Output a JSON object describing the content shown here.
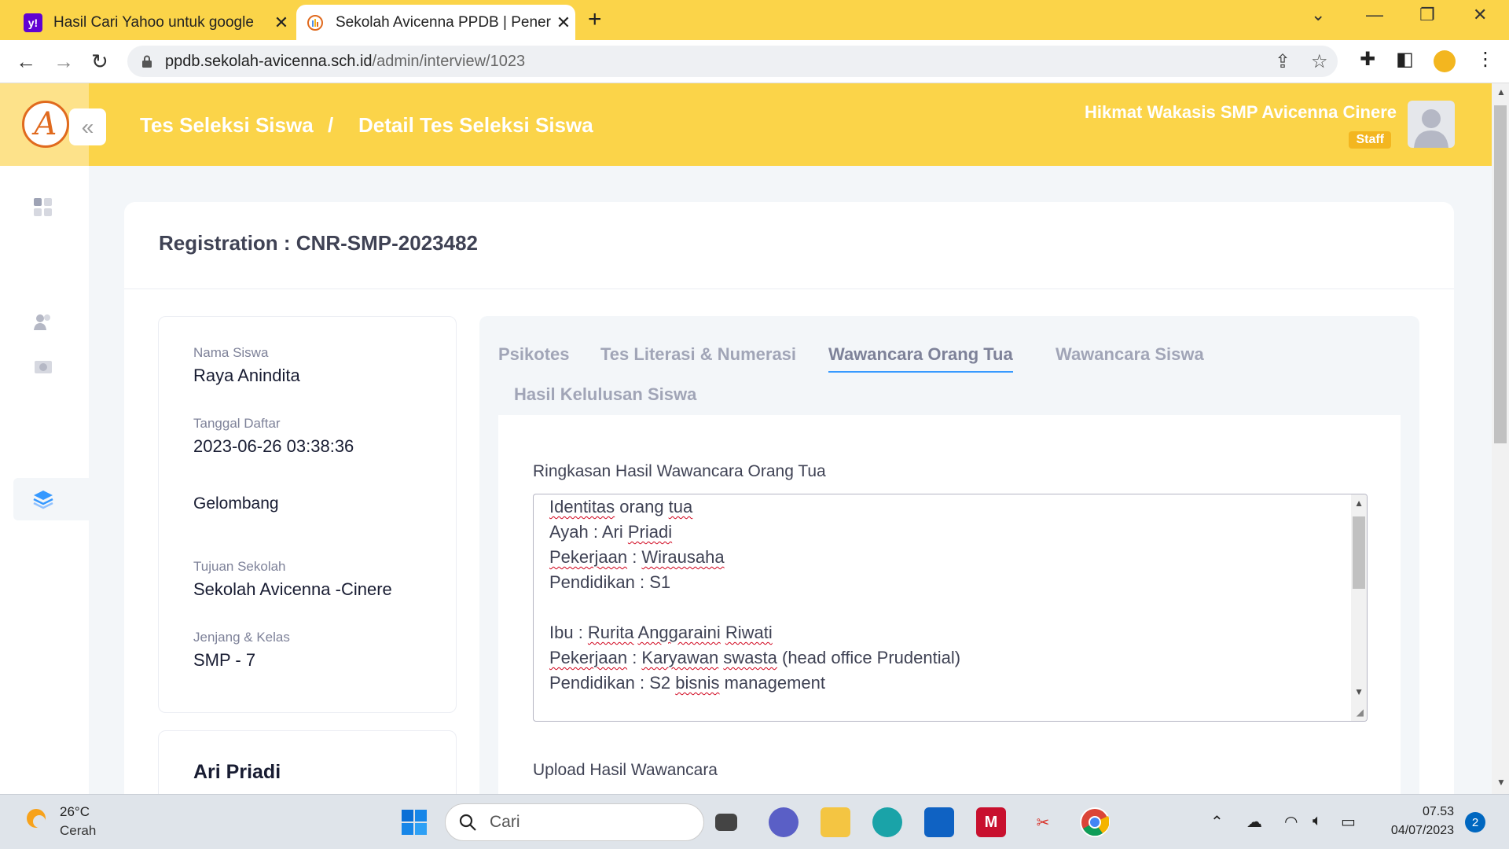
{
  "browser": {
    "tabs": [
      {
        "title": "Hasil Cari Yahoo untuk google",
        "favicon": "y!"
      },
      {
        "title": "Sekolah Avicenna PPDB | Penerim",
        "favicon": "avicenna"
      }
    ],
    "url_host": "ppdb.sekolah-avicenna.sch.id",
    "url_path": "/admin/interview/1023"
  },
  "header": {
    "breadcrumb_1": "Tes Seleksi Siswa",
    "separator": "/",
    "breadcrumb_2": "Detail Tes Seleksi Siswa",
    "user_name": "Hikmat Wakasis SMP Avicenna Cinere",
    "user_role": "Staff"
  },
  "registration": "Registration : CNR-SMP-2023482",
  "student": {
    "name_label": "Nama Siswa",
    "name": "Raya Anindita",
    "date_label": "Tanggal Daftar",
    "date": "2023-06-26 03:38:36",
    "wave_label": "Gelombang",
    "school_label": "Tujuan Sekolah",
    "school": "Sekolah Avicenna -Cinere",
    "level_label": "Jenjang & Kelas",
    "level": "SMP - 7"
  },
  "parent_card": {
    "name": "Ari Priadi"
  },
  "tabs": [
    "Psikotes",
    "Tes Literasi & Numerasi",
    "Wawancara Orang Tua",
    "Wawancara Siswa",
    "Hasil Kelulusan Siswa"
  ],
  "interview": {
    "summary_label": "Ringkasan Hasil Wawancara Orang Tua",
    "lines": [
      "Identitas orang tua",
      "Ayah : Ari Priadi",
      "Pekerjaan : Wirausaha",
      "Pendidikan : S1",
      "",
      "Ibu : Rurita Anggaraini Riwati",
      "Pekerjaan : Karyawan swasta (head office Prudential)",
      "Pendidikan : S2 bisnis management"
    ],
    "upload_label": "Upload Hasil Wawancara"
  },
  "taskbar": {
    "temp": "26°C",
    "condition": "Cerah",
    "search_placeholder": "Cari",
    "time": "07.53",
    "date": "04/07/2023",
    "notifications": "2"
  },
  "colors": {
    "brand_yellow": "#fbd449",
    "accent_blue": "#3699ff"
  }
}
